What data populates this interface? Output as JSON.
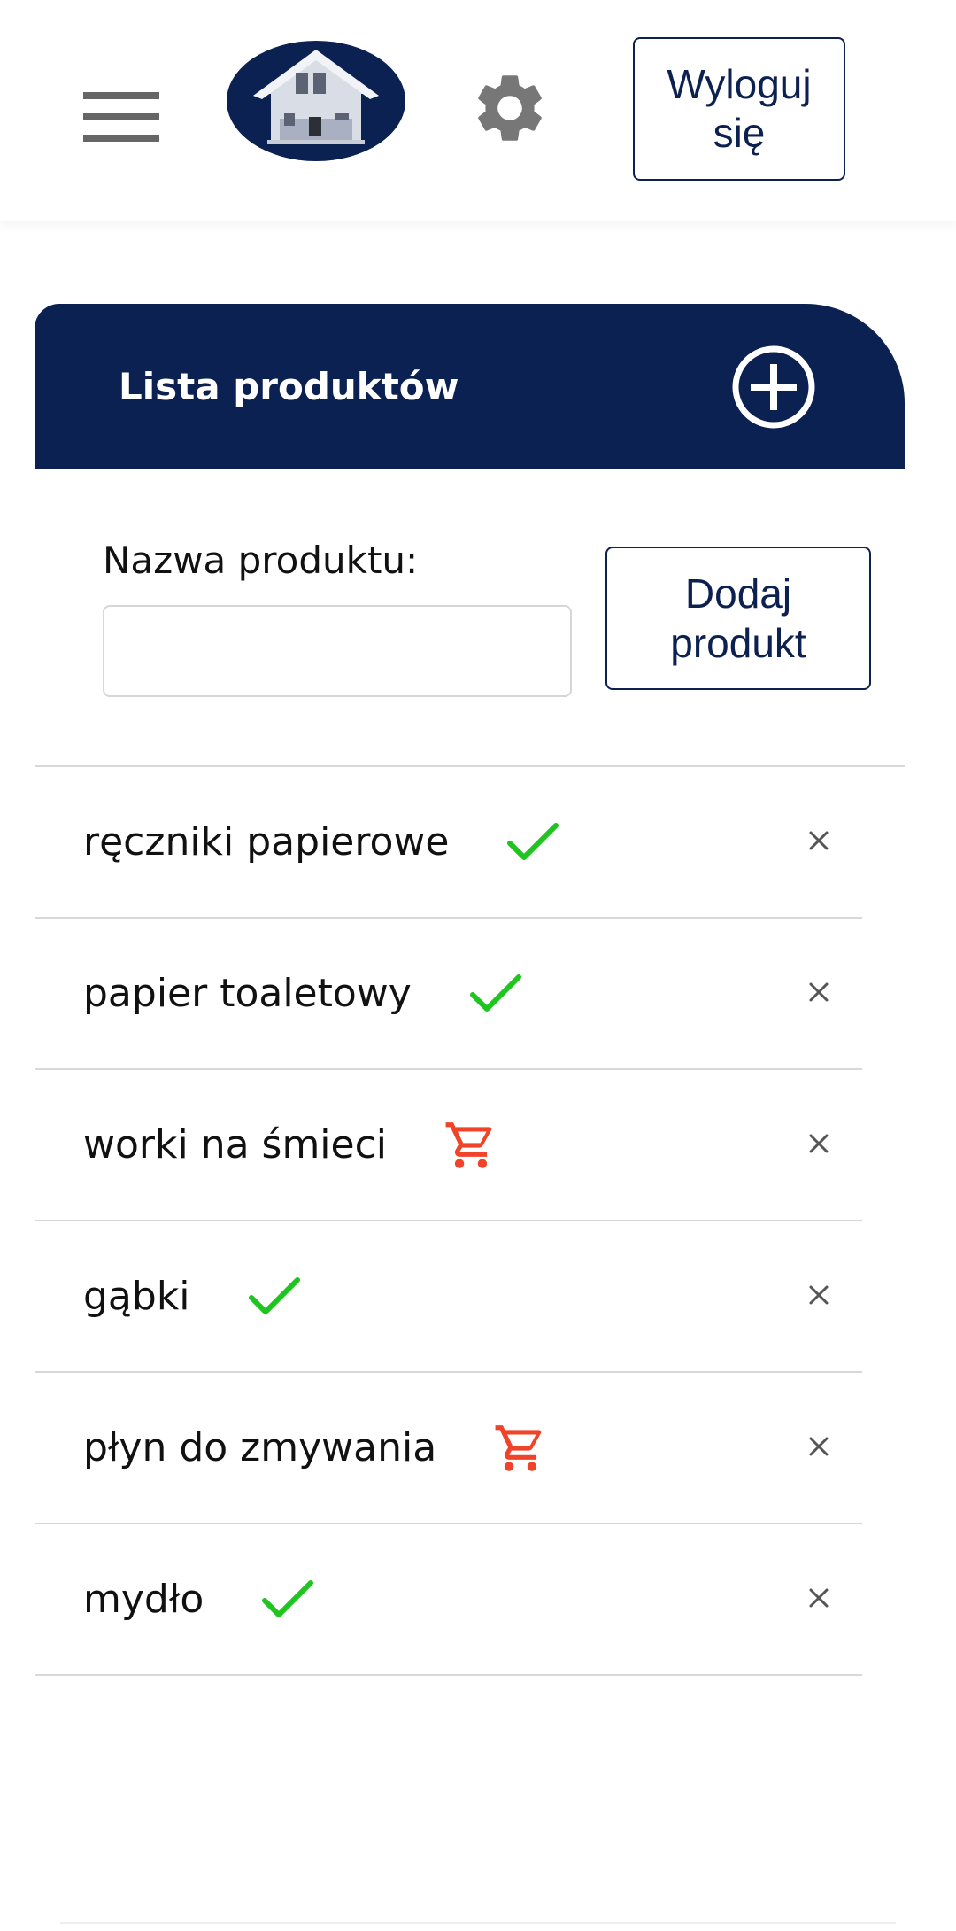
{
  "header": {
    "logout_label": "Wyloguj\nsię",
    "icons": {
      "menu": "hamburger-menu-icon",
      "logo": "house-logo",
      "settings": "gear-icon"
    }
  },
  "panel": {
    "title": "Lista produktów",
    "add_icon": "plus-circle-icon"
  },
  "form": {
    "label": "Nazwa produktu:",
    "input_value": "",
    "input_placeholder": "",
    "submit_label": "Dodaj\nprodukt"
  },
  "products": [
    {
      "name": "ręczniki papierowe",
      "status": "done"
    },
    {
      "name": "papier toaletowy",
      "status": "done"
    },
    {
      "name": "worki na śmieci",
      "status": "to-buy"
    },
    {
      "name": "gąbki",
      "status": "done"
    },
    {
      "name": "płyn do zmywania",
      "status": "to-buy"
    },
    {
      "name": "mydło",
      "status": "done"
    }
  ],
  "colors": {
    "navy": "#0b2152",
    "check_green": "#1ec51e",
    "cart_red": "#f0442a",
    "divider": "#d8d8d8",
    "icon_grey": "#666666"
  }
}
